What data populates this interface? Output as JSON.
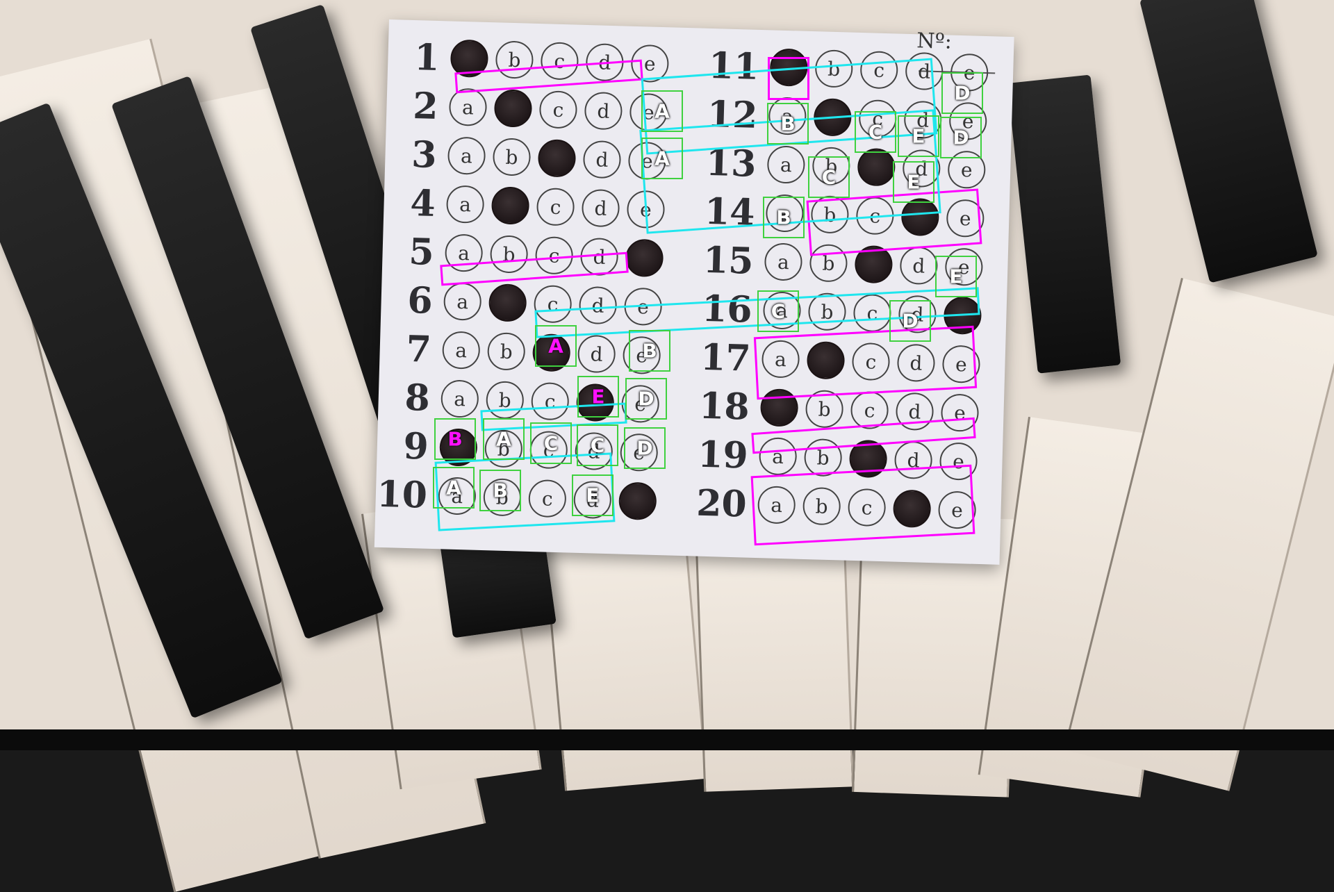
{
  "header": {
    "number_label": "Nº:"
  },
  "sheet": {
    "left_column": [
      {
        "q": "1",
        "choices": [
          "a",
          "b",
          "c",
          "d",
          "e"
        ],
        "filled": 0
      },
      {
        "q": "2",
        "choices": [
          "a",
          "b",
          "c",
          "d",
          "e"
        ],
        "filled": 1
      },
      {
        "q": "3",
        "choices": [
          "a",
          "b",
          "c",
          "d",
          "e"
        ],
        "filled": 2
      },
      {
        "q": "4",
        "choices": [
          "a",
          "b",
          "c",
          "d",
          "e"
        ],
        "filled": 1
      },
      {
        "q": "5",
        "choices": [
          "a",
          "b",
          "c",
          "d",
          "e"
        ],
        "filled": 4
      },
      {
        "q": "6",
        "choices": [
          "a",
          "b",
          "c",
          "d",
          "e"
        ],
        "filled": 1
      },
      {
        "q": "7",
        "choices": [
          "a",
          "b",
          "c",
          "d",
          "e"
        ],
        "filled": 2
      },
      {
        "q": "8",
        "choices": [
          "a",
          "b",
          "c",
          "d",
          "e"
        ],
        "filled": 3
      },
      {
        "q": "9",
        "choices": [
          "a",
          "b",
          "c",
          "d",
          "e"
        ],
        "filled": 0
      },
      {
        "q": "10",
        "choices": [
          "a",
          "b",
          "c",
          "d",
          "e"
        ],
        "filled": 4
      }
    ],
    "right_column": [
      {
        "q": "11",
        "choices": [
          "a",
          "b",
          "c",
          "d",
          "e"
        ],
        "filled": 0
      },
      {
        "q": "12",
        "choices": [
          "a",
          "b",
          "c",
          "d",
          "e"
        ],
        "filled": 1
      },
      {
        "q": "13",
        "choices": [
          "a",
          "b",
          "c",
          "d",
          "e"
        ],
        "filled": 2
      },
      {
        "q": "14",
        "choices": [
          "a",
          "b",
          "c",
          "d",
          "e"
        ],
        "filled": 3
      },
      {
        "q": "15",
        "choices": [
          "a",
          "b",
          "c",
          "d",
          "e"
        ],
        "filled": 2
      },
      {
        "q": "16",
        "choices": [
          "a",
          "b",
          "c",
          "d",
          "e"
        ],
        "filled": 4
      },
      {
        "q": "17",
        "choices": [
          "a",
          "b",
          "c",
          "d",
          "e"
        ],
        "filled": 1
      },
      {
        "q": "18",
        "choices": [
          "a",
          "b",
          "c",
          "d",
          "e"
        ],
        "filled": 0
      },
      {
        "q": "19",
        "choices": [
          "a",
          "b",
          "c",
          "d",
          "e"
        ],
        "filled": 2
      },
      {
        "q": "20",
        "choices": [
          "a",
          "b",
          "c",
          "d",
          "e"
        ],
        "filled": 3
      }
    ]
  },
  "overlay": {
    "colors": {
      "predicted": "#ff00ff",
      "answer_key": "#3fd13f",
      "group": "#1fe6ee"
    },
    "answer_key_letters": [
      {
        "q": "2",
        "letter": "A"
      },
      {
        "q": "3",
        "letter": "A"
      },
      {
        "q": "7",
        "letter": "A"
      },
      {
        "q": "7",
        "letter": "B"
      },
      {
        "q": "8",
        "letter": "E"
      },
      {
        "q": "8",
        "letter": "D"
      },
      {
        "q": "9",
        "letter": "B"
      },
      {
        "q": "9",
        "letter": "A"
      },
      {
        "q": "9",
        "letter": "C"
      },
      {
        "q": "9",
        "letter": "C"
      },
      {
        "q": "9",
        "letter": "D"
      },
      {
        "q": "10",
        "letter": "A"
      },
      {
        "q": "10",
        "letter": "B"
      },
      {
        "q": "10",
        "letter": "E"
      },
      {
        "q": "11",
        "letter": "D"
      },
      {
        "q": "12",
        "letter": "B"
      },
      {
        "q": "12",
        "letter": "C"
      },
      {
        "q": "12",
        "letter": "E"
      },
      {
        "q": "12",
        "letter": "D"
      },
      {
        "q": "13",
        "letter": "C"
      },
      {
        "q": "13",
        "letter": "E"
      },
      {
        "q": "14",
        "letter": "B"
      },
      {
        "q": "15",
        "letter": "E"
      },
      {
        "q": "16",
        "letter": "C"
      },
      {
        "q": "16",
        "letter": "D"
      }
    ]
  }
}
